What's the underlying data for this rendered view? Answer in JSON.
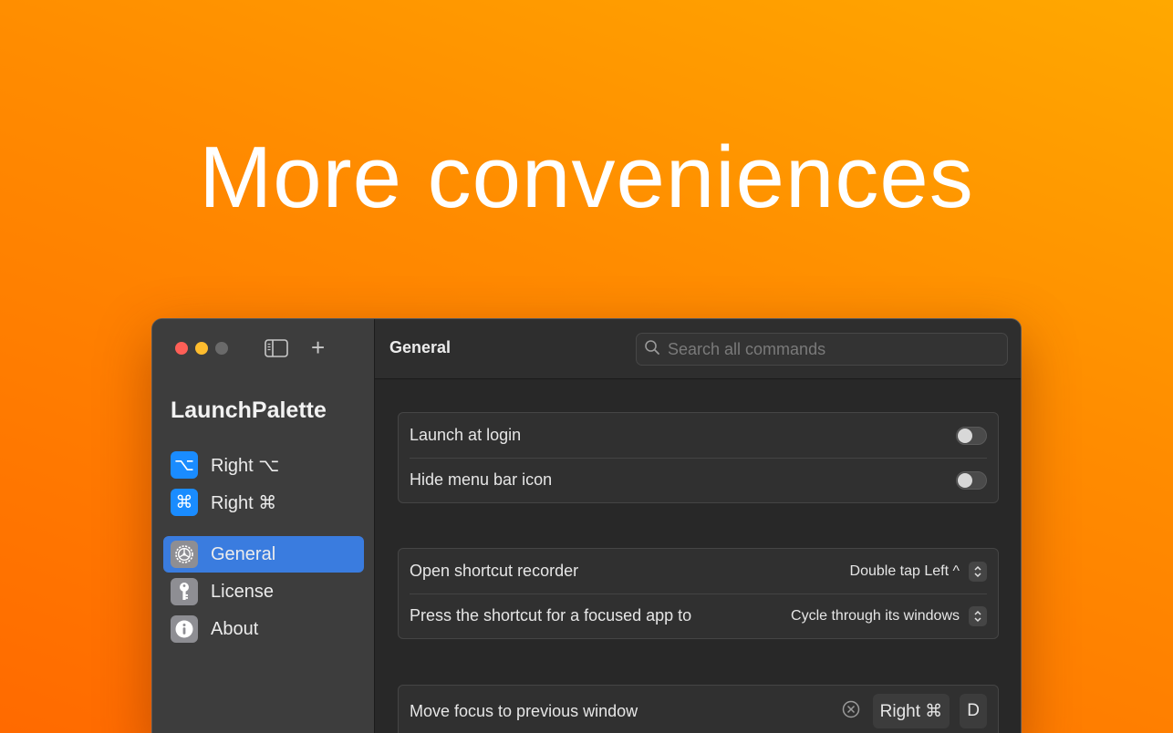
{
  "headline": "More conveniences",
  "window": {
    "sidebar": {
      "app_title": "LaunchPalette",
      "plus_symbol": "+",
      "items": [
        {
          "label": "Right ⌥",
          "icon_glyph": "⌥",
          "icon": "option-key-icon",
          "active": false
        },
        {
          "label": "Right ⌘",
          "icon_glyph": "⌘",
          "icon": "command-key-icon",
          "active": false
        },
        {
          "label": "General",
          "icon": "gear-icon",
          "active": true
        },
        {
          "label": "License",
          "icon": "key-icon",
          "active": false
        },
        {
          "label": "About",
          "icon": "info-icon",
          "active": false
        }
      ]
    },
    "toolbar": {
      "title": "General",
      "search_placeholder": "Search all commands"
    },
    "groups": [
      {
        "rows": [
          {
            "label": "Launch at login",
            "toggle": false
          },
          {
            "label": "Hide menu bar icon",
            "toggle": false
          }
        ]
      },
      {
        "rows": [
          {
            "label": "Open shortcut recorder",
            "value": "Double tap Left ^"
          },
          {
            "label": "Press the shortcut for a focused app to",
            "value": "Cycle through its windows"
          }
        ]
      },
      {
        "rows": [
          {
            "label": "Move focus to previous window",
            "keys": [
              "Right ⌘",
              "D"
            ]
          }
        ]
      }
    ]
  },
  "colors": {
    "accent": "#3a7cdf",
    "icon_blue": "#1a8cff",
    "background_top": "#ffa800",
    "background_bottom": "#ff6a00"
  }
}
